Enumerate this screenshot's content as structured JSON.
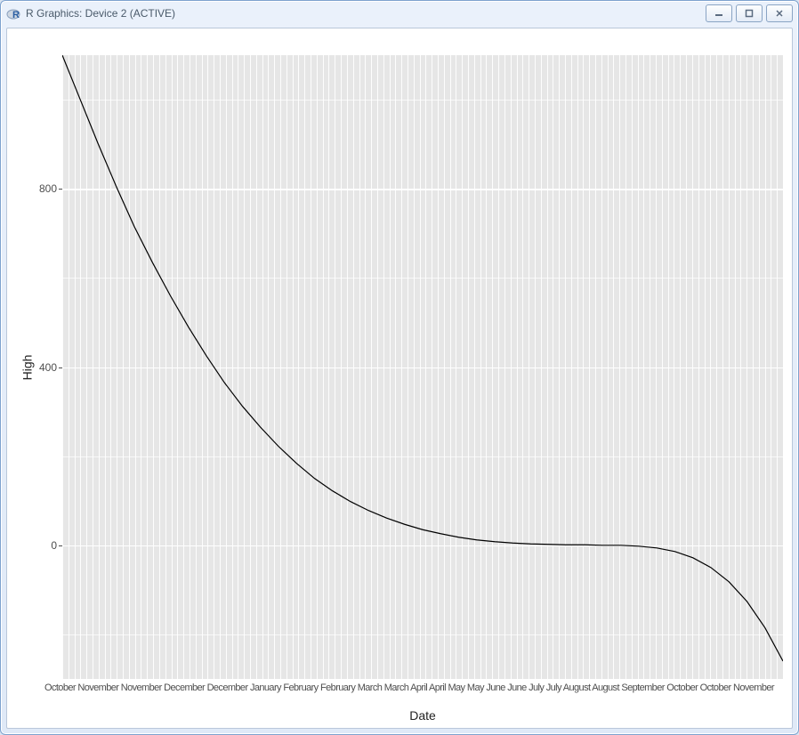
{
  "window": {
    "title": "R Graphics: Device 2 (ACTIVE)",
    "controls": {
      "minimize": "minimize",
      "maximize": "maximize",
      "close": "close"
    }
  },
  "chart_data": {
    "type": "line",
    "xlabel": "Date",
    "ylabel": "High",
    "ylim": [
      -300,
      1100
    ],
    "y_ticks": [
      0,
      400,
      800
    ],
    "x_tick_strip": "October November November December December January February February March March April April May May June June July July August August September October October November",
    "series": [
      {
        "name": "High",
        "x": [
          0.0,
          0.025,
          0.05,
          0.075,
          0.1,
          0.125,
          0.15,
          0.175,
          0.2,
          0.225,
          0.25,
          0.275,
          0.3,
          0.325,
          0.35,
          0.375,
          0.4,
          0.425,
          0.45,
          0.475,
          0.5,
          0.525,
          0.55,
          0.575,
          0.6,
          0.625,
          0.65,
          0.675,
          0.7,
          0.725,
          0.75,
          0.775,
          0.8,
          0.825,
          0.85,
          0.875,
          0.9,
          0.925,
          0.95,
          0.975,
          1.0
        ],
        "values": [
          1100,
          1000,
          900,
          805,
          715,
          635,
          560,
          490,
          425,
          365,
          312,
          265,
          222,
          184,
          150,
          122,
          98,
          78,
          61,
          47,
          35,
          26,
          18,
          12,
          8,
          5,
          3,
          2,
          1,
          1,
          0,
          0,
          -2,
          -6,
          -14,
          -28,
          -50,
          -82,
          -126,
          -185,
          -260
        ]
      }
    ]
  }
}
